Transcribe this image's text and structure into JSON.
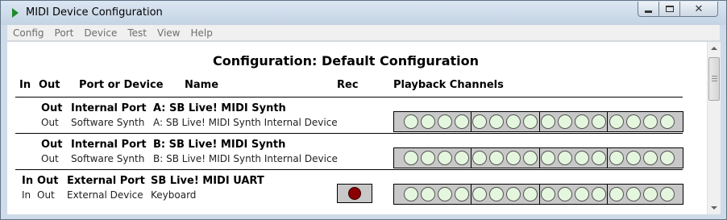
{
  "window": {
    "title": "MIDI Device Configuration"
  },
  "menu": [
    "Config",
    "Port",
    "Device",
    "Test",
    "View",
    "Help"
  ],
  "heading": "Configuration: Default Configuration",
  "columns": {
    "in": "In",
    "out": "Out",
    "port": "Port or Device",
    "name": "Name",
    "rec": "Rec",
    "playback": "Playback Channels"
  },
  "rows": [
    {
      "line1": {
        "in": "",
        "out": "Out",
        "port": "Internal Port",
        "name": "A: SB Live! MIDI Synth"
      },
      "line2": {
        "in": "",
        "out": "Out",
        "port": "Software Synth",
        "name": "A: SB Live! MIDI Synth Internal Device"
      },
      "rec": false
    },
    {
      "line1": {
        "in": "",
        "out": "Out",
        "port": "Internal Port",
        "name": "B: SB Live! MIDI Synth"
      },
      "line2": {
        "in": "",
        "out": "Out",
        "port": "Software Synth",
        "name": "B: SB Live! MIDI Synth Internal Device"
      },
      "rec": false
    },
    {
      "line1": {
        "in": "In",
        "out": "Out",
        "port": "External Port",
        "name": "SB Live! MIDI UART"
      },
      "line2": {
        "in": "In",
        "out": "Out",
        "port": "External Device",
        "name": "Keyboard"
      },
      "rec": true
    }
  ],
  "channel_count": 16,
  "colors": {
    "channel_off": "#e4f7de",
    "rec_on": "#8a0000",
    "panel": "#c8c8c8"
  }
}
